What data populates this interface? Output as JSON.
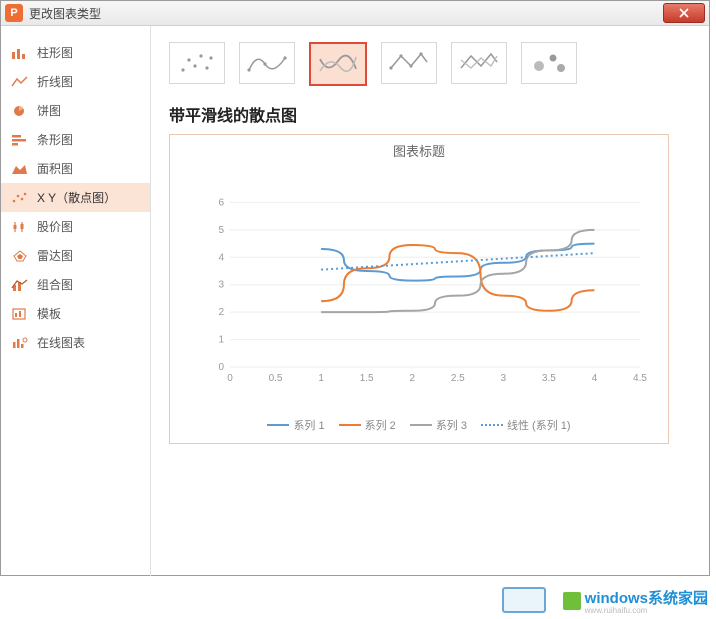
{
  "dialog": {
    "title": "更改图表类型",
    "close_icon": "close"
  },
  "sidebar": {
    "items": [
      {
        "label": "柱形图",
        "icon": "bar"
      },
      {
        "label": "折线图",
        "icon": "line"
      },
      {
        "label": "饼图",
        "icon": "pie"
      },
      {
        "label": "条形图",
        "icon": "hbar"
      },
      {
        "label": "面积图",
        "icon": "area"
      },
      {
        "label": "X Y（散点图）",
        "icon": "scatter",
        "selected": true
      },
      {
        "label": "股价图",
        "icon": "stock"
      },
      {
        "label": "雷达图",
        "icon": "radar"
      },
      {
        "label": "组合图",
        "icon": "combo"
      },
      {
        "label": "模板",
        "icon": "template"
      },
      {
        "label": "在线图表",
        "icon": "online"
      }
    ]
  },
  "subtypes": [
    {
      "name": "scatter-dots"
    },
    {
      "name": "scatter-smooth-marker"
    },
    {
      "name": "scatter-smooth",
      "selected": true
    },
    {
      "name": "scatter-line-marker"
    },
    {
      "name": "scatter-line"
    },
    {
      "name": "bubble"
    }
  ],
  "main": {
    "heading": "带平滑线的散点图"
  },
  "chart_data": {
    "type": "line",
    "title": "图表标题",
    "xlabel": "",
    "ylabel": "",
    "xlim": [
      0,
      4.5
    ],
    "ylim": [
      0,
      7
    ],
    "xticks": [
      0,
      0.5,
      1,
      1.5,
      2,
      2.5,
      3,
      3.5,
      4,
      4.5
    ],
    "yticks": [
      0,
      1,
      2,
      3,
      4,
      5,
      6
    ],
    "legend": [
      "系列 1",
      "系列 2",
      "系列 3",
      "线性 (系列 1)"
    ],
    "series": [
      {
        "name": "系列 1",
        "color": "#5a9bd5",
        "x": [
          1,
          1.5,
          2,
          2.5,
          3,
          3.5,
          4
        ],
        "y": [
          4.3,
          3.5,
          3.15,
          3.3,
          3.8,
          4.25,
          4.5
        ]
      },
      {
        "name": "系列 2",
        "color": "#ed7d31",
        "x": [
          1,
          1.5,
          2,
          2.5,
          3,
          3.5,
          4
        ],
        "y": [
          2.4,
          3.6,
          4.45,
          4.15,
          2.6,
          2.05,
          2.8
        ]
      },
      {
        "name": "系列 3",
        "color": "#a5a5a5",
        "x": [
          1,
          1.5,
          2,
          2.5,
          3,
          3.5,
          4
        ],
        "y": [
          2.0,
          2.0,
          2.05,
          2.6,
          3.4,
          4.25,
          5.0
        ]
      },
      {
        "name": "线性 (系列 1)",
        "color": "#5a9bd5",
        "style": "dotted",
        "x": [
          1,
          4
        ],
        "y": [
          3.55,
          4.15
        ]
      }
    ]
  },
  "watermark": {
    "brand": "windows系统家园",
    "url": "www.ruihaifu.com"
  }
}
